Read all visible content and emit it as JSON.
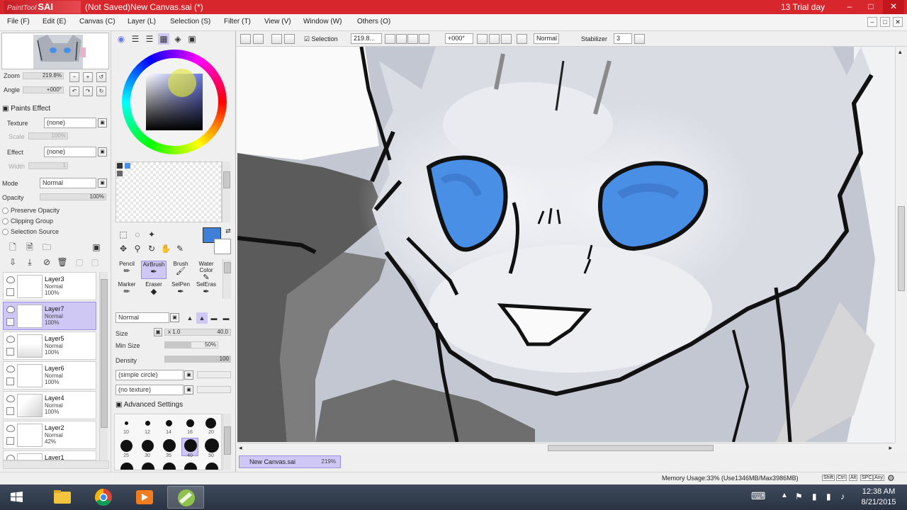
{
  "titlebar": {
    "app_name_prefix": "PaintTool",
    "app_name": "SAI",
    "document_title": "(Not Saved)New Canvas.sai (*)",
    "trial_text": "13 Trial day",
    "minimize": "–",
    "maximize": "□",
    "close": "✕"
  },
  "menu": {
    "items": [
      "File (F)",
      "Edit (E)",
      "Canvas (C)",
      "Layer (L)",
      "Selection (S)",
      "Filter (T)",
      "View (V)",
      "Window (W)",
      "Others (O)"
    ]
  },
  "navigator": {
    "zoom_label": "Zoom",
    "zoom_value": "219.8%",
    "angle_label": "Angle",
    "angle_value": "+000°"
  },
  "paint_effect": {
    "header": "Paints Effect",
    "texture_label": "Texture",
    "texture_value": "(none)",
    "texture_sub": "Scale",
    "texture_sub_value": "100%",
    "effect_label": "Effect",
    "effect_value": "(none)",
    "effect_sub": "Width",
    "effect_sub_value": "1"
  },
  "layer_props": {
    "mode_label": "Mode",
    "mode_value": "Normal",
    "opacity_label": "Opacity",
    "opacity_value": "100%",
    "preserve_opacity": "Preserve Opacity",
    "clipping_group": "Clipping Group",
    "selection_source": "Selection Source"
  },
  "layers": [
    {
      "name": "Layer3",
      "mode": "Normal",
      "opacity": "100%",
      "active": false
    },
    {
      "name": "Layer7",
      "mode": "Normal",
      "opacity": "100%",
      "active": true
    },
    {
      "name": "Layer5",
      "mode": "Normal",
      "opacity": "100%",
      "active": false
    },
    {
      "name": "Layer6",
      "mode": "Normal",
      "opacity": "100%",
      "active": false
    },
    {
      "name": "Layer4",
      "mode": "Normal",
      "opacity": "100%",
      "active": false
    },
    {
      "name": "Layer2",
      "mode": "Normal",
      "opacity": "42%",
      "active": false
    },
    {
      "name": "Layer1",
      "mode": "",
      "opacity": "",
      "active": false
    }
  ],
  "brushes": {
    "row1": [
      "Pencil",
      "AirBrush",
      "Brush",
      "Water Color"
    ],
    "row2": [
      "Marker",
      "Eraser",
      "SelPen",
      "SelEras"
    ],
    "active": "AirBrush",
    "blend_mode": "Normal",
    "size_label": "Size",
    "size_multiplier": "x 1.0",
    "size_value": "40.0",
    "min_size_label": "Min Size",
    "min_size_value": "50%",
    "density_label": "Density",
    "density_value": "100",
    "shape": "(simple circle)",
    "texture": "(no texture)",
    "advanced_settings": "Advanced Settings",
    "size_presets": [
      "10",
      "12",
      "14",
      "16",
      "20",
      "25",
      "30",
      "35",
      "40",
      "50"
    ]
  },
  "canvas_toolbar": {
    "selection_label": "Selection",
    "zoom_value": "219.8...",
    "angle_value": "+000°",
    "mode_value": "Normal",
    "stabilizer_label": "Stabilizer",
    "stabilizer_value": "3"
  },
  "tabs": [
    {
      "label": "New Canvas.sai",
      "zoom": "219%"
    }
  ],
  "status": {
    "memory": "Memory Usage:33% (Use1346MB/Max3986MB)",
    "indicators": [
      "Shift",
      "Ctrl",
      "Alt",
      "SPC",
      "Any"
    ]
  },
  "taskbar": {
    "time": "12:38 AM",
    "date": "8/21/2015"
  },
  "colors": {
    "titlebar": "#d8262d",
    "accent_selected": "#cfc8f4",
    "current_color": "#3f7fd8",
    "eye_blue": "#4a8fe6"
  },
  "icons": [
    "windows-start-icon",
    "file-explorer-icon",
    "chrome-icon",
    "media-player-icon",
    "sai-app-icon",
    "keyboard-icon",
    "network-icon",
    "volume-icon"
  ]
}
